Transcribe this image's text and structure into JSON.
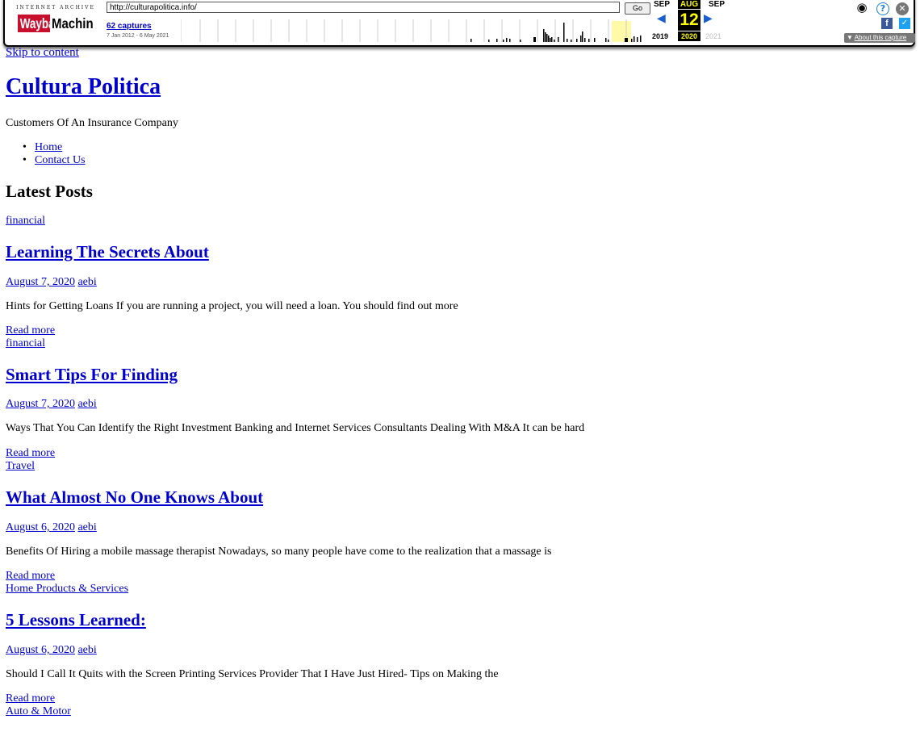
{
  "wayback": {
    "logo_top": "INTERNET ARCHIVE",
    "logo_main": "WaybackMachine",
    "url": "http://culturapolitica.info/",
    "go_label": "Go",
    "captures": "62 captures",
    "date_range": "7 Jan 2012 - 6 May 2021",
    "months": [
      "SEP",
      "AUG",
      "SEP"
    ],
    "day": "12",
    "years": [
      "2019",
      "2020",
      "2021"
    ],
    "about_label": "About this capture",
    "icons": [
      "user-icon",
      "help-icon",
      "close-icon",
      "facebook-icon",
      "twitter-icon",
      "prev-arrow-icon",
      "next-arrow-icon"
    ],
    "highlight_color": "#fff9a8"
  },
  "page": {
    "skip_link": "Skip to content",
    "site_title": "Cultura Politica",
    "tagline": "Customers Of An Insurance Company",
    "nav": [
      "Home",
      "Contact Us"
    ],
    "latest_heading": "Latest Posts",
    "posts": [
      {
        "category": "financial",
        "title": "Learning The Secrets About",
        "date": "August 7, 2020",
        "author": "aebi",
        "excerpt": "Hints for Getting Loans If you are running a project, you will need a loan. You should find out more",
        "read_more": "Read more"
      },
      {
        "category": "financial",
        "title": "Smart Tips For Finding",
        "date": "August 7, 2020",
        "author": "aebi",
        "excerpt": "Ways That You Can Identify the Right Investment Banking and Internet Services Consultants Dealing With M&A It can be hard",
        "read_more": "Read more"
      },
      {
        "category": "Travel",
        "title": "What Almost No One Knows About",
        "date": "August 6, 2020",
        "author": "aebi",
        "excerpt": "Benefits Of Hiring a mobile massage therapist Nowadays, so many people have come to the realization that a massage is",
        "read_more": "Read more"
      },
      {
        "category": "Home Products & Services",
        "title": "5 Lessons Learned:",
        "date": "August 6, 2020",
        "author": "aebi",
        "excerpt": "Should I Call It Quits with the Screen Printing Services Provider That I Have Just Hired- Tips on Making the",
        "read_more": "Read more"
      }
    ],
    "next_category": "Auto & Motor"
  }
}
